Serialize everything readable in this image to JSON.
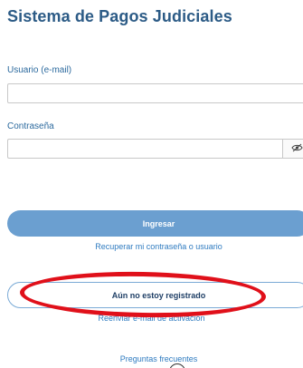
{
  "page": {
    "title": "Sistema de Pagos Judiciales"
  },
  "form": {
    "username_label": "Usuario (e-mail)",
    "username_value": "",
    "password_label": "Contraseña",
    "password_value": "",
    "show_password_icon": "eye-slash-icon"
  },
  "actions": {
    "login_label": "Ingresar",
    "recover_link": "Recuperar mi contraseña o usuario",
    "register_label": "Aún no estoy registrado",
    "resend_mail_link": "Reenviar e-mail de activación",
    "faq_link": "Preguntas frecuentes",
    "help_icon": "help-circle-icon"
  },
  "annotation": {
    "highlight_color": "#e0101a"
  },
  "colors": {
    "title": "#2c5b86",
    "primary_button": "#6b9fd0",
    "link": "#2f7bc0"
  }
}
